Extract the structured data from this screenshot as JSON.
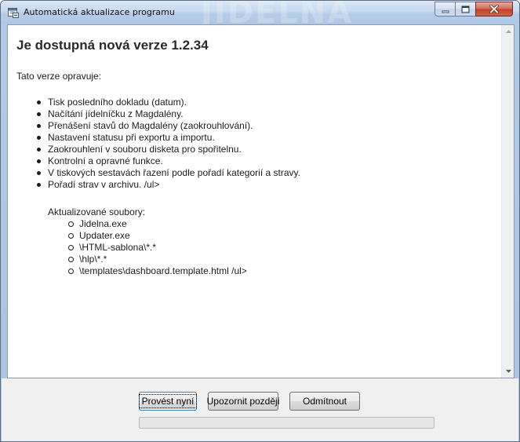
{
  "window": {
    "title": "Automatická aktualizace programu",
    "watermark": "JIDELNA"
  },
  "colors": {
    "title_bar": "#b6cde8",
    "close_button": "#c2412a",
    "heading_text": "#2a2a2a",
    "default_button_border": "#3c7fb1"
  },
  "icons": {
    "app": "app-window-icon",
    "minimize": "minimize-icon",
    "maximize": "maximize-icon",
    "close": "close-icon",
    "scroll_up": "scroll-up-arrow-icon",
    "scroll_down": "scroll-down-arrow-icon"
  },
  "content": {
    "heading": "Je dostupná nová verze 1.2.34",
    "intro": "Tato verze opravuje:",
    "fixes": [
      "Tisk posledního dokladu (datum).",
      "Načítání jídelníčku z Magdalény.",
      "Přenášení stavů do Magdalény (zaokrouhlování).",
      "Nastavení statusu při exportu a importu.",
      "Zaokrouhlení v souboru disketa pro spořitelnu.",
      "Kontrolní a opravné funkce.",
      "V tiskových sestavách řazení podle pořadí kategorií a stravy.",
      "Pořadí strav v archivu. /ul>"
    ],
    "files_label": "Aktualizované soubory:",
    "files": [
      "Jidelna.exe",
      "Updater.exe",
      "\\HTML-sablona\\*.*",
      "\\hlp\\*.*",
      "\\templates\\dashboard.template.html /ul>"
    ]
  },
  "buttons": {
    "install_now": "Provést nyní",
    "remind_later": "Upozornit později",
    "decline": "Odmítnout"
  },
  "progress": {
    "value": 0
  }
}
